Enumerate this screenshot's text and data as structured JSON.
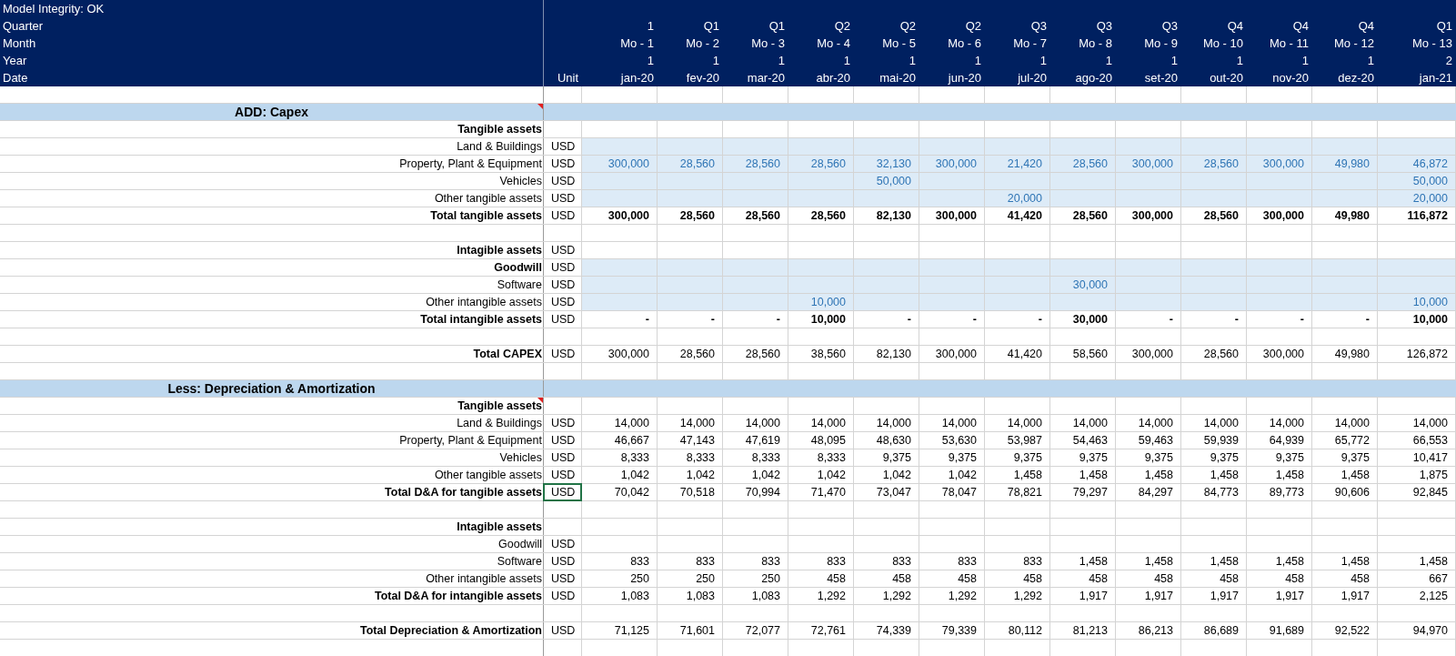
{
  "header": {
    "title": "Model Integrity: OK",
    "row_labels": [
      "Quarter",
      "Month",
      "Year",
      "Date"
    ],
    "unit_heading": "Unit",
    "columns": [
      {
        "quarter": "1",
        "month": "Mo - 1",
        "year": "1",
        "date": "jan-20"
      },
      {
        "quarter": "Q1",
        "month": "Mo - 2",
        "year": "1",
        "date": "fev-20"
      },
      {
        "quarter": "Q1",
        "month": "Mo - 3",
        "year": "1",
        "date": "mar-20"
      },
      {
        "quarter": "Q2",
        "month": "Mo - 4",
        "year": "1",
        "date": "abr-20"
      },
      {
        "quarter": "Q2",
        "month": "Mo - 5",
        "year": "1",
        "date": "mai-20"
      },
      {
        "quarter": "Q2",
        "month": "Mo - 6",
        "year": "1",
        "date": "jun-20"
      },
      {
        "quarter": "Q3",
        "month": "Mo - 7",
        "year": "1",
        "date": "jul-20"
      },
      {
        "quarter": "Q3",
        "month": "Mo - 8",
        "year": "1",
        "date": "ago-20"
      },
      {
        "quarter": "Q3",
        "month": "Mo - 9",
        "year": "1",
        "date": "set-20"
      },
      {
        "quarter": "Q4",
        "month": "Mo - 10",
        "year": "1",
        "date": "out-20"
      },
      {
        "quarter": "Q4",
        "month": "Mo - 11",
        "year": "1",
        "date": "nov-20"
      },
      {
        "quarter": "Q4",
        "month": "Mo - 12",
        "year": "1",
        "date": "dez-20"
      },
      {
        "quarter": "Q1",
        "month": "Mo - 13",
        "year": "2",
        "date": "jan-21"
      }
    ]
  },
  "rows": [
    {
      "kind": "blank"
    },
    {
      "kind": "section",
      "title": "ADD: Capex",
      "comment": true
    },
    {
      "kind": "data",
      "label": "Tangible assets",
      "label_bold": true,
      "input": false,
      "comment": false
    },
    {
      "kind": "data",
      "label": "Land & Buildings",
      "label_bold": false,
      "unit": "USD",
      "input": true,
      "comment": false,
      "selected": false
    },
    {
      "kind": "data",
      "label": "Property, Plant & Equipment",
      "label_bold": false,
      "unit": "USD",
      "values_bold": false,
      "input": true,
      "comment": false,
      "selected": false,
      "values": {
        "col_1": "300,000",
        "col_2": "28,560",
        "col_3": "28,560",
        "col_4": "28,560",
        "col_5": "32,130",
        "col_6": "300,000",
        "col_7": "21,420",
        "col_8": "28,560",
        "col_9": "300,000",
        "col_10": "28,560",
        "col_11": "300,000",
        "col_12": "49,980",
        "col_13": "46,872"
      }
    },
    {
      "kind": "data",
      "label": "Vehicles",
      "label_bold": false,
      "unit": "USD",
      "values_bold": false,
      "input": true,
      "comment": false,
      "selected": false,
      "values": {
        "col_5": "50,000",
        "col_13": "50,000"
      }
    },
    {
      "kind": "data",
      "label": "Other tangible assets",
      "label_bold": false,
      "unit": "USD",
      "values_bold": false,
      "input": true,
      "comment": false,
      "selected": false,
      "values": {
        "col_7": "20,000",
        "col_13": "20,000"
      }
    },
    {
      "kind": "data",
      "label": "Total tangible assets",
      "label_bold": true,
      "unit": "USD",
      "values_bold": true,
      "input": false,
      "comment": false,
      "selected": false,
      "values": {
        "col_1": "300,000",
        "col_2": "28,560",
        "col_3": "28,560",
        "col_4": "28,560",
        "col_5": "82,130",
        "col_6": "300,000",
        "col_7": "41,420",
        "col_8": "28,560",
        "col_9": "300,000",
        "col_10": "28,560",
        "col_11": "300,000",
        "col_12": "49,980",
        "col_13": "116,872"
      }
    },
    {
      "kind": "blank"
    },
    {
      "kind": "data",
      "label": "Intagible assets",
      "label_bold": true,
      "unit": "USD",
      "input": false,
      "comment": false,
      "selected": false
    },
    {
      "kind": "data",
      "label": "Goodwill",
      "label_bold": true,
      "unit": "USD",
      "input": true,
      "comment": false,
      "selected": false
    },
    {
      "kind": "data",
      "label": "Software",
      "label_bold": false,
      "unit": "USD",
      "values_bold": false,
      "input": true,
      "comment": false,
      "selected": false,
      "values": {
        "col_8": "30,000"
      }
    },
    {
      "kind": "data",
      "label": "Other intangible assets",
      "label_bold": false,
      "unit": "USD",
      "values_bold": false,
      "input": true,
      "comment": false,
      "selected": false,
      "values": {
        "col_4": "10,000",
        "col_13": "10,000"
      }
    },
    {
      "kind": "data",
      "label": "Total intangible assets",
      "label_bold": true,
      "unit": "USD",
      "values_bold": true,
      "input": false,
      "comment": false,
      "selected": false,
      "values": {
        "col_1": "-",
        "col_2": "-",
        "col_3": "-",
        "col_4": "10,000",
        "col_5": "-",
        "col_6": "-",
        "col_7": "-",
        "col_8": "30,000",
        "col_9": "-",
        "col_10": "-",
        "col_11": "-",
        "col_12": "-",
        "col_13": "10,000"
      }
    },
    {
      "kind": "blank"
    },
    {
      "kind": "data",
      "label": "Total CAPEX",
      "label_bold": true,
      "unit": "USD",
      "values_bold": false,
      "input": false,
      "comment": false,
      "selected": false,
      "values": {
        "col_1": "300,000",
        "col_2": "28,560",
        "col_3": "28,560",
        "col_4": "38,560",
        "col_5": "82,130",
        "col_6": "300,000",
        "col_7": "41,420",
        "col_8": "58,560",
        "col_9": "300,000",
        "col_10": "28,560",
        "col_11": "300,000",
        "col_12": "49,980",
        "col_13": "126,872"
      }
    },
    {
      "kind": "blank"
    },
    {
      "kind": "section",
      "title": "Less: Depreciation & Amortization",
      "comment": false
    },
    {
      "kind": "data",
      "label": "Tangible assets",
      "label_bold": true,
      "input": false,
      "comment": true
    },
    {
      "kind": "data",
      "label": "Land & Buildings",
      "label_bold": false,
      "unit": "USD",
      "values_bold": false,
      "input": false,
      "comment": false,
      "selected": false,
      "values": {
        "col_1": "14,000",
        "col_2": "14,000",
        "col_3": "14,000",
        "col_4": "14,000",
        "col_5": "14,000",
        "col_6": "14,000",
        "col_7": "14,000",
        "col_8": "14,000",
        "col_9": "14,000",
        "col_10": "14,000",
        "col_11": "14,000",
        "col_12": "14,000",
        "col_13": "14,000"
      }
    },
    {
      "kind": "data",
      "label": "Property, Plant & Equipment",
      "label_bold": false,
      "unit": "USD",
      "values_bold": false,
      "input": false,
      "comment": false,
      "selected": false,
      "values": {
        "col_1": "46,667",
        "col_2": "47,143",
        "col_3": "47,619",
        "col_4": "48,095",
        "col_5": "48,630",
        "col_6": "53,630",
        "col_7": "53,987",
        "col_8": "54,463",
        "col_9": "59,463",
        "col_10": "59,939",
        "col_11": "64,939",
        "col_12": "65,772",
        "col_13": "66,553"
      }
    },
    {
      "kind": "data",
      "label": "Vehicles",
      "label_bold": false,
      "unit": "USD",
      "values_bold": false,
      "input": false,
      "comment": false,
      "selected": false,
      "values": {
        "col_1": "8,333",
        "col_2": "8,333",
        "col_3": "8,333",
        "col_4": "8,333",
        "col_5": "9,375",
        "col_6": "9,375",
        "col_7": "9,375",
        "col_8": "9,375",
        "col_9": "9,375",
        "col_10": "9,375",
        "col_11": "9,375",
        "col_12": "9,375",
        "col_13": "10,417"
      }
    },
    {
      "kind": "data",
      "label": "Other tangible assets",
      "label_bold": false,
      "unit": "USD",
      "values_bold": false,
      "input": false,
      "comment": false,
      "selected": false,
      "values": {
        "col_1": "1,042",
        "col_2": "1,042",
        "col_3": "1,042",
        "col_4": "1,042",
        "col_5": "1,042",
        "col_6": "1,042",
        "col_7": "1,458",
        "col_8": "1,458",
        "col_9": "1,458",
        "col_10": "1,458",
        "col_11": "1,458",
        "col_12": "1,458",
        "col_13": "1,875"
      }
    },
    {
      "kind": "data",
      "label": "Total D&A for tangible assets",
      "label_bold": true,
      "unit": "USD",
      "values_bold": false,
      "input": false,
      "comment": false,
      "selected": true,
      "values": {
        "col_1": "70,042",
        "col_2": "70,518",
        "col_3": "70,994",
        "col_4": "71,470",
        "col_5": "73,047",
        "col_6": "78,047",
        "col_7": "78,821",
        "col_8": "79,297",
        "col_9": "84,297",
        "col_10": "84,773",
        "col_11": "89,773",
        "col_12": "90,606",
        "col_13": "92,845"
      }
    },
    {
      "kind": "blank"
    },
    {
      "kind": "data",
      "label": "Intagible assets",
      "label_bold": true,
      "input": false,
      "comment": false
    },
    {
      "kind": "data",
      "label": "Goodwill",
      "label_bold": false,
      "unit": "USD",
      "input": false,
      "comment": false,
      "selected": false
    },
    {
      "kind": "data",
      "label": "Software",
      "label_bold": false,
      "unit": "USD",
      "values_bold": false,
      "input": false,
      "comment": false,
      "selected": false,
      "values": {
        "col_1": "833",
        "col_2": "833",
        "col_3": "833",
        "col_4": "833",
        "col_5": "833",
        "col_6": "833",
        "col_7": "833",
        "col_8": "1,458",
        "col_9": "1,458",
        "col_10": "1,458",
        "col_11": "1,458",
        "col_12": "1,458",
        "col_13": "1,458"
      }
    },
    {
      "kind": "data",
      "label": "Other intangible assets",
      "label_bold": false,
      "unit": "USD",
      "values_bold": false,
      "input": false,
      "comment": false,
      "selected": false,
      "values": {
        "col_1": "250",
        "col_2": "250",
        "col_3": "250",
        "col_4": "458",
        "col_5": "458",
        "col_6": "458",
        "col_7": "458",
        "col_8": "458",
        "col_9": "458",
        "col_10": "458",
        "col_11": "458",
        "col_12": "458",
        "col_13": "667"
      }
    },
    {
      "kind": "data",
      "label": "Total D&A for intangible assets",
      "label_bold": true,
      "unit": "USD",
      "values_bold": false,
      "input": false,
      "comment": false,
      "selected": false,
      "values": {
        "col_1": "1,083",
        "col_2": "1,083",
        "col_3": "1,083",
        "col_4": "1,292",
        "col_5": "1,292",
        "col_6": "1,292",
        "col_7": "1,292",
        "col_8": "1,917",
        "col_9": "1,917",
        "col_10": "1,917",
        "col_11": "1,917",
        "col_12": "1,917",
        "col_13": "2,125"
      }
    },
    {
      "kind": "blank"
    },
    {
      "kind": "data",
      "label": "Total Depreciation & Amortization",
      "label_bold": true,
      "unit": "USD",
      "values_bold": false,
      "input": false,
      "comment": false,
      "selected": false,
      "values": {
        "col_1": "71,125",
        "col_2": "71,601",
        "col_3": "72,077",
        "col_4": "72,761",
        "col_5": "74,339",
        "col_6": "79,339",
        "col_7": "80,112",
        "col_8": "81,213",
        "col_9": "86,213",
        "col_10": "86,689",
        "col_11": "91,689",
        "col_12": "92,522",
        "col_13": "94,970"
      }
    },
    {
      "kind": "blank"
    }
  ]
}
